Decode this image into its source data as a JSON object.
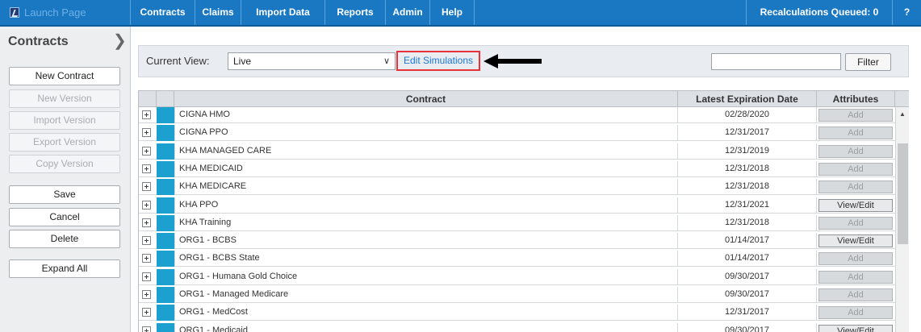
{
  "topbar": {
    "launch_label": "Launch Page",
    "nav": [
      "Contracts",
      "Claims",
      "Import Data",
      "Reports",
      "Admin",
      "Help"
    ],
    "recalc_label": "Recalculations Queued: 0",
    "help_label": "?"
  },
  "sidebar": {
    "title": "Contracts",
    "collapse_icon": "chevron-right",
    "buttons": {
      "new_contract": "New Contract",
      "new_version": "New Version",
      "import_version": "Import Version",
      "export_version": "Export Version",
      "copy_version": "Copy Version",
      "save": "Save",
      "cancel": "Cancel",
      "delete": "Delete",
      "expand_all": "Expand All"
    }
  },
  "view": {
    "label": "Current View:",
    "selected": "Live",
    "edit_simulations": "Edit Simulations",
    "filter_value": "",
    "filter_button": "Filter"
  },
  "grid": {
    "columns": [
      "Contract",
      "Latest Expiration Date",
      "Attributes"
    ],
    "rows": [
      {
        "name": "CIGNA HMO",
        "date": "02/28/2020",
        "attr": "Add"
      },
      {
        "name": "CIGNA PPO",
        "date": "12/31/2017",
        "attr": "Add"
      },
      {
        "name": "KHA MANAGED CARE",
        "date": "12/31/2019",
        "attr": "Add"
      },
      {
        "name": "KHA MEDICAID",
        "date": "12/31/2018",
        "attr": "Add"
      },
      {
        "name": "KHA MEDICARE",
        "date": "12/31/2018",
        "attr": "Add"
      },
      {
        "name": "KHA PPO",
        "date": "12/31/2021",
        "attr": "View/Edit"
      },
      {
        "name": "KHA Training",
        "date": "12/31/2018",
        "attr": "Add"
      },
      {
        "name": "ORG1 - BCBS",
        "date": "01/14/2017",
        "attr": "View/Edit"
      },
      {
        "name": "ORG1 - BCBS State",
        "date": "01/14/2017",
        "attr": "Add"
      },
      {
        "name": "ORG1 - Humana Gold Choice",
        "date": "09/30/2017",
        "attr": "Add"
      },
      {
        "name": "ORG1 - Managed Medicare",
        "date": "09/30/2017",
        "attr": "Add"
      },
      {
        "name": "ORG1 - MedCost",
        "date": "12/31/2017",
        "attr": "Add"
      },
      {
        "name": "ORG1 - Medicaid",
        "date": "09/30/2017",
        "attr": "View/Edit"
      }
    ]
  },
  "colors": {
    "topbar": "#1a78c2",
    "row_marker": "#1ba0cf",
    "highlight_border": "#e8323a",
    "link": "#1d78d1"
  }
}
